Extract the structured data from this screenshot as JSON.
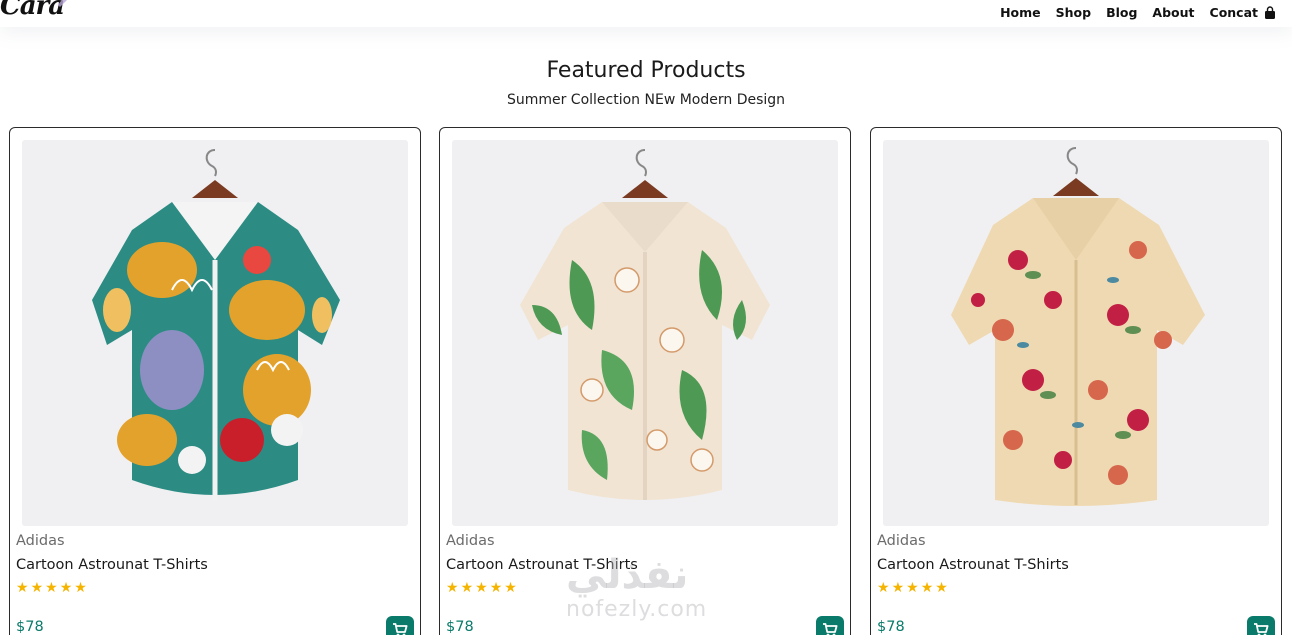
{
  "header": {
    "logo_text": "Cara",
    "nav": [
      {
        "label": "Home"
      },
      {
        "label": "Shop"
      },
      {
        "label": "Blog"
      },
      {
        "label": "About"
      },
      {
        "label": "Concat"
      }
    ],
    "cart_icon": "shopping-bag-icon"
  },
  "section": {
    "title": "Featured Products",
    "subtitle": "Summer Collection NEw Modern Design"
  },
  "products": [
    {
      "brand": "Adidas",
      "name": "Cartoon Astrounat T-Shirts",
      "rating": 5,
      "price": "$78",
      "image": "abstract-print-shirt"
    },
    {
      "brand": "Adidas",
      "name": "Cartoon Astrounat T-Shirts",
      "rating": 5,
      "price": "$78",
      "image": "tropical-leaf-shirt"
    },
    {
      "brand": "Adidas",
      "name": "Cartoon Astrounat T-Shirts",
      "rating": 5,
      "price": "$78",
      "image": "floral-rose-shirt"
    }
  ],
  "watermark": {
    "line1": "نفذلي",
    "line2": "nofezly.com"
  },
  "colors": {
    "accent": "#0a7b6a",
    "star": "#f5b400",
    "muted_text": "#6b6b6b",
    "image_bg": "#f0f0f2"
  }
}
